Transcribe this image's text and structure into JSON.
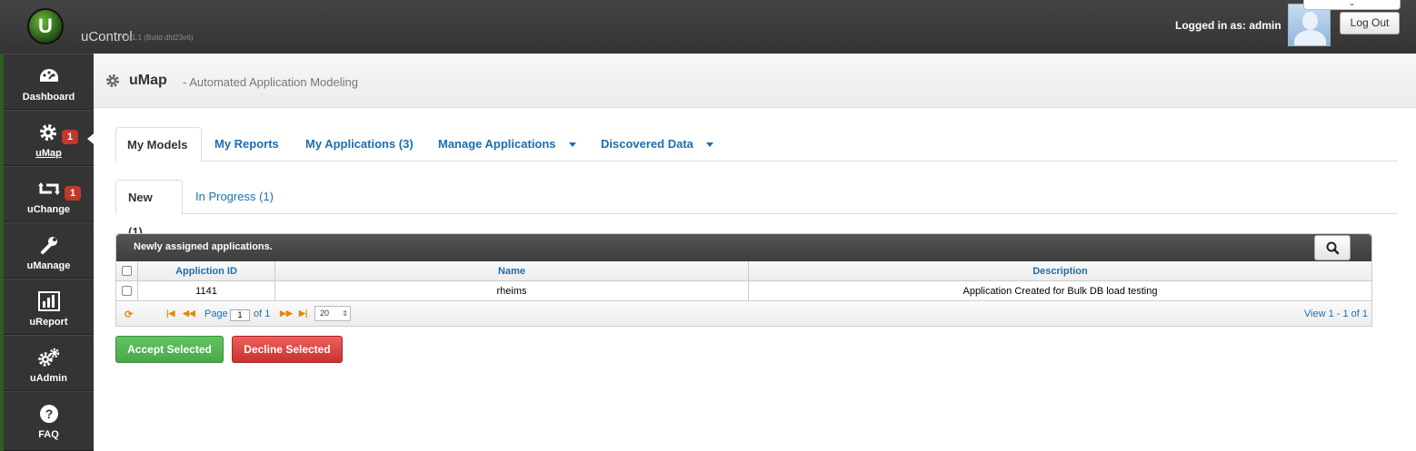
{
  "header": {
    "logo_letter": "U",
    "app_name": "uControl",
    "version": "V1.1.1 (Build dfd23e6)",
    "logged_in_text": "Logged in as: admin",
    "logout_label": "Log Out"
  },
  "sidebar": {
    "items": [
      {
        "label": "Dashboard",
        "icon": "dashboard-icon"
      },
      {
        "label": "uMap",
        "icon": "gear-icon",
        "badge": "1",
        "active": true
      },
      {
        "label": "uChange",
        "icon": "retweet-icon",
        "badge": "1"
      },
      {
        "label": "uManage",
        "icon": "wrench-icon"
      },
      {
        "label": "uReport",
        "icon": "bar-chart-icon"
      },
      {
        "label": "uAdmin",
        "icon": "gears-icon"
      },
      {
        "label": "FAQ",
        "icon": "question-icon"
      }
    ]
  },
  "page": {
    "title": "uMap",
    "subtitle": "- Automated Application Modeling"
  },
  "tabs": [
    {
      "label": "My Models",
      "active": true
    },
    {
      "label": "My Reports"
    },
    {
      "label": "My Applications (3)"
    },
    {
      "label": "Manage Applications",
      "dropdown": true
    },
    {
      "label": "Discovered Data",
      "dropdown": true
    }
  ],
  "subtabs": [
    {
      "label": "New (1)",
      "active": true
    },
    {
      "label": "In Progress (1)"
    }
  ],
  "grid": {
    "caption": "Newly assigned applications.",
    "columns": [
      "Appliction ID",
      "Name",
      "Description"
    ],
    "rows": [
      {
        "id": "1141",
        "name": "rheims",
        "description": "Application Created for Bulk DB load testing"
      }
    ],
    "pager": {
      "page_label": "Page",
      "page_value": "1",
      "of_label": "of 1",
      "rows_per_page": "20",
      "view_info": "View 1 - 1 of 1"
    }
  },
  "actions": {
    "accept_label": "Accept Selected",
    "decline_label": "Decline Selected"
  },
  "colors": {
    "accent": "#1a6fb3",
    "accept": "#5bb75b",
    "decline": "#da4f49",
    "badge": "#c0392b"
  }
}
